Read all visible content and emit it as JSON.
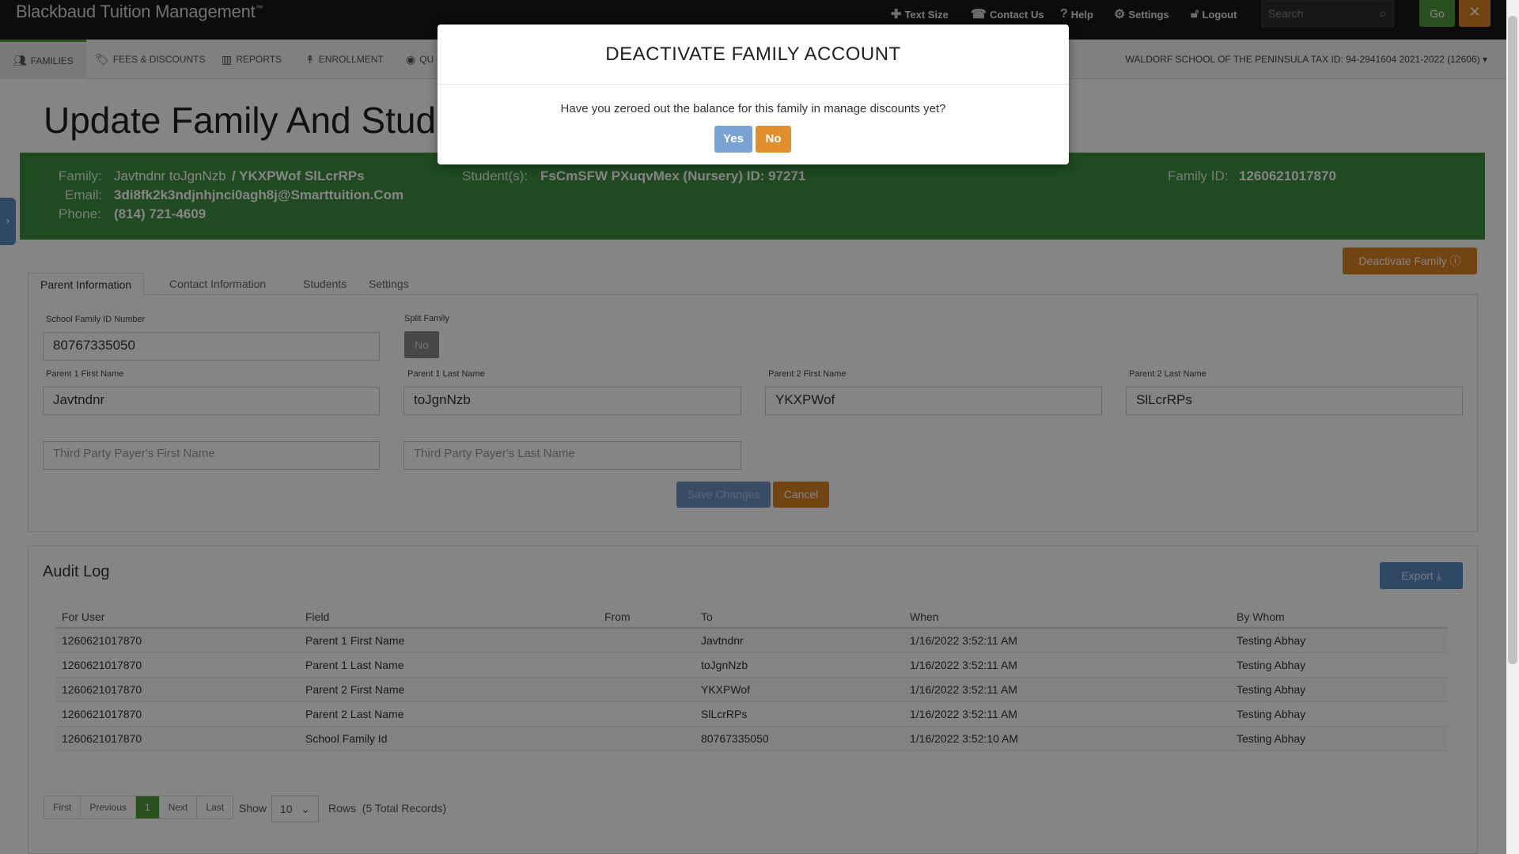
{
  "app": {
    "brand": "Blackbaud Tuition Management",
    "brand_mark": "™"
  },
  "topnav": {
    "text_size": "Text Size",
    "contact_us": "Contact Us",
    "help": "Help",
    "settings": "Settings",
    "logout": "Logout",
    "search_placeholder": "Search",
    "go": "Go",
    "close": "✕"
  },
  "mainnav": {
    "items": [
      "FAMILIES",
      "FEES & DISCOUNTS",
      "REPORTS",
      "ENROLLMENT",
      "QU"
    ],
    "school_info": "WALDORF SCHOOL OF THE PENINSULA TAX ID: 94-2941604 2021-2022 (12606)"
  },
  "page": {
    "title": "Update Family And Stude"
  },
  "family": {
    "family_label": "Family:",
    "family_value": "Javtndnr toJgnNzb",
    "family_value2": "/ YKXPWof SlLcrRPs",
    "email_label": "Email:",
    "email_value": "3di8fk2k3ndjnhjnci0agh8j@Smarttuition.Com",
    "phone_label": "Phone:",
    "phone_value": "(814) 721-4609",
    "students_label": "Student(s):",
    "students_value": "FsCmSFW PXuqvMex (Nursery) ID: 97271",
    "family_id_label": "Family ID:",
    "family_id_value": "1260621017870"
  },
  "actions": {
    "deactivate": "Deactivate Family",
    "save": "Save Changes",
    "cancel": "Cancel",
    "export": "Export"
  },
  "tabs": [
    "Parent Information",
    "Contact Information",
    "Students",
    "Settings"
  ],
  "form": {
    "school_family_id_label": "School Family ID Number",
    "school_family_id_value": "80767335050",
    "split_family_label": "Split Family",
    "split_family_value": "No",
    "p1_first_label": "Parent 1 First Name",
    "p1_first_value": "Javtndnr",
    "p1_last_label": "Parent 1 Last Name",
    "p1_last_value": "toJgnNzb",
    "p2_first_label": "Parent 2 First Name",
    "p2_first_value": "YKXPWof",
    "p2_last_label": "Parent 2 Last Name",
    "p2_last_value": "SlLcrRPs",
    "tp_first_placeholder": "Third Party Payer's First Name",
    "tp_last_placeholder": "Third Party Payer's Last Name"
  },
  "audit": {
    "title": "Audit Log",
    "headers": [
      "For User",
      "Field",
      "From",
      "To",
      "When",
      "By Whom"
    ],
    "rows": [
      [
        "1260621017870",
        "Parent 1 First Name",
        "",
        "Javtndnr",
        "1/16/2022 3:52:11 AM",
        "Testing Abhay"
      ],
      [
        "1260621017870",
        "Parent 1 Last Name",
        "",
        "toJgnNzb",
        "1/16/2022 3:52:11 AM",
        "Testing Abhay"
      ],
      [
        "1260621017870",
        "Parent 2 First Name",
        "",
        "YKXPWof",
        "1/16/2022 3:52:11 AM",
        "Testing Abhay"
      ],
      [
        "1260621017870",
        "Parent 2 Last Name",
        "",
        "SlLcrRPs",
        "1/16/2022 3:52:11 AM",
        "Testing Abhay"
      ],
      [
        "1260621017870",
        "School Family Id",
        "",
        "80767335050",
        "1/16/2022 3:52:10 AM",
        "Testing Abhay"
      ]
    ]
  },
  "pager": {
    "first": "First",
    "previous": "Previous",
    "current": "1",
    "next": "Next",
    "last": "Last",
    "show": "Show",
    "page_size": "10",
    "rows": "Rows",
    "total": "(5 Total Records)"
  },
  "modal": {
    "title": "DEACTIVATE FAMILY ACCOUNT",
    "message": "Have you zeroed out the balance for this family in manage discounts yet?",
    "yes": "Yes",
    "no": "No"
  },
  "colors": {
    "accent_green": "#3e8e3e",
    "accent_orange": "#d98324",
    "accent_blue": "#5a8bc2"
  }
}
